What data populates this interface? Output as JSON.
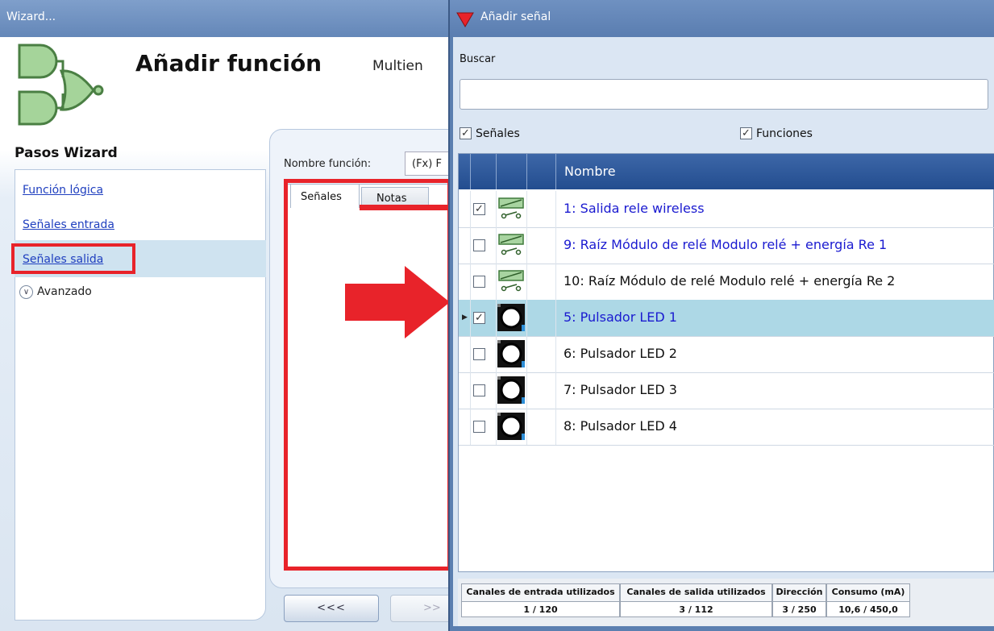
{
  "wizard": {
    "window_title": "Wizard...",
    "heading": "Añadir función",
    "subtitle": "Multien",
    "steps_title": "Pasos Wizard",
    "steps": [
      "Función lógica",
      "Señales entrada",
      "Señales salida"
    ],
    "advanced_label": "Avanzado",
    "function_name_label": "Nombre función:",
    "function_name_value": "(Fx) F",
    "tabs": [
      "Señales",
      "Notas"
    ],
    "back_button": "<<<",
    "next_button": ">>"
  },
  "dialog": {
    "title": "Añadir señal",
    "search_label": "Buscar",
    "search_value": "",
    "filter_signals": {
      "label": "Señales",
      "checked": true
    },
    "filter_functions": {
      "label": "Funciones",
      "checked": true
    },
    "column_name": "Nombre",
    "rows": [
      {
        "name": "1: Salida rele wireless",
        "checked": true,
        "icon": "relay-icon",
        "color": "#1a1ad0",
        "selected": false
      },
      {
        "name": "9: Raíz Módulo de relé Modulo relé + energía Re 1",
        "checked": false,
        "icon": "relay-icon",
        "color": "#1a1ad0",
        "selected": false
      },
      {
        "name": "10: Raíz Módulo de relé Modulo relé + energía Re 2",
        "checked": false,
        "icon": "relay-icon",
        "color": "#111111",
        "selected": false
      },
      {
        "name": "5: Pulsador LED 1",
        "checked": true,
        "icon": "pushbutton-icon",
        "color": "#1a1ad0",
        "selected": true
      },
      {
        "name": "6: Pulsador LED 2",
        "checked": false,
        "icon": "pushbutton-icon",
        "color": "#111111",
        "selected": false
      },
      {
        "name": "7: Pulsador LED 3",
        "checked": false,
        "icon": "pushbutton-icon",
        "color": "#111111",
        "selected": false
      },
      {
        "name": "8: Pulsador LED 4",
        "checked": false,
        "icon": "pushbutton-icon",
        "color": "#111111",
        "selected": false
      }
    ],
    "status": [
      {
        "label": "Canales de entrada utilizados",
        "value": "1 / 120"
      },
      {
        "label": "Canales de salida utilizados",
        "value": "3 / 112"
      },
      {
        "label": "Dirección",
        "value": "3 / 250"
      },
      {
        "label": "Consumo (mA)",
        "value": "10,6 / 450,0"
      }
    ]
  },
  "colors": {
    "highlight": "#e8232a",
    "selected_row": "#add8e6",
    "link": "#1f3fbf"
  }
}
